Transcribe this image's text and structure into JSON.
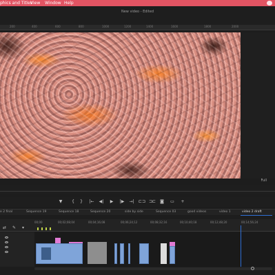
{
  "menubar": {
    "items": [
      "phics and Titles",
      "View",
      "Window",
      "Help"
    ]
  },
  "window": {
    "title": "New video - Edited"
  },
  "ruler": {
    "ticks": [
      "200",
      "400",
      "600",
      "800",
      "1000",
      "1200",
      "1400",
      "1600",
      "1800",
      "2000"
    ]
  },
  "program_monitor": {
    "fit_label": "Full"
  },
  "transport": {
    "buttons": [
      "marker-icon",
      "in-point-icon",
      "out-point-icon",
      "go-to-in-icon",
      "step-back-icon",
      "play-icon",
      "step-forward-icon",
      "go-to-out-icon",
      "insert-icon",
      "overwrite-icon",
      "export-frame-icon",
      "comparison-icon",
      "add-icon"
    ],
    "glyphs": [
      "▼",
      "{",
      "}",
      "|←",
      "◀|",
      "▶",
      "|▶",
      "→|",
      "⊏⊐",
      "⊐⊏",
      "◙",
      "▭",
      "+"
    ]
  },
  "sequence_tabs": [
    "e 2 final",
    "Sequence 19",
    "Sequence 18",
    "Sequence 20",
    "side by side",
    "Sequence 03",
    "good videos",
    "video 1",
    "video 2 draft"
  ],
  "active_tab": "video 2 draft",
  "timecodes": [
    "00;00",
    "00;02;08;04",
    "00;04;16;08",
    "00;06;24;12",
    "00;08;32;16",
    "00;10;40;18",
    "00;12;48;20",
    "00;14;56;24"
  ],
  "colors": {
    "menubar": "#e25463",
    "accent_blue": "#2f6fd6",
    "clip_blue": "#7fa4d9",
    "clip_pink": "#e07ad3",
    "marker_green": "#c3d64a"
  }
}
